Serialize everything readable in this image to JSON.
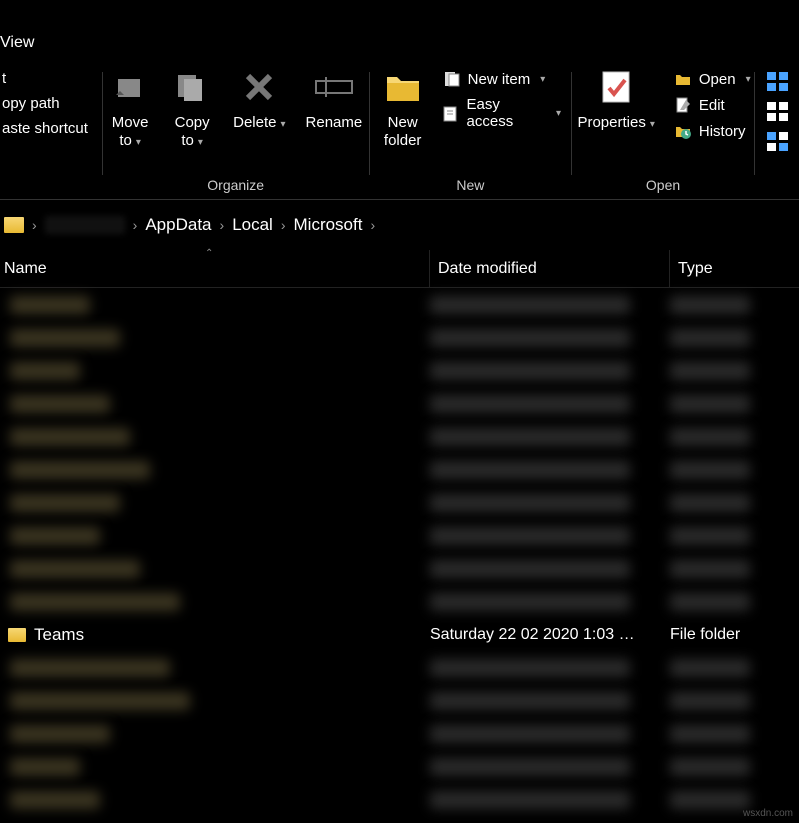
{
  "tab": {
    "view": "View"
  },
  "ribbon": {
    "clipboard": {
      "cut": "t",
      "copy_path": "opy path",
      "paste_shortcut": "aste shortcut"
    },
    "organize": {
      "label": "Organize",
      "move_to": "Move\nto",
      "copy_to": "Copy\nto",
      "delete": "Delete",
      "rename": "Rename"
    },
    "new": {
      "label": "New",
      "new_folder": "New\nfolder",
      "new_item": "New item",
      "easy_access": "Easy access"
    },
    "open": {
      "label": "Open",
      "properties": "Properties",
      "open": "Open",
      "edit": "Edit",
      "history": "History"
    }
  },
  "breadcrumb": {
    "items": [
      "AppData",
      "Local",
      "Microsoft"
    ]
  },
  "columns": {
    "name": "Name",
    "date": "Date modified",
    "type": "Type"
  },
  "visible_row": {
    "name": "Teams",
    "date": "Saturday 22 02 2020 1:03 …",
    "type": "File folder"
  },
  "watermark": "wsxdn.com"
}
